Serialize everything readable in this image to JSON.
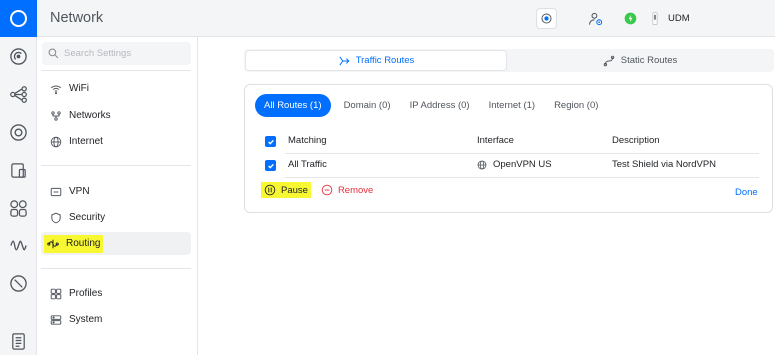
{
  "app": {
    "title": "Network"
  },
  "topbar": {
    "device_name": "UDM",
    "icons": [
      "settings-gear-icon",
      "admin-user-gear-icon",
      "status-ok-icon",
      "device-icon"
    ],
    "status_color": "#38c94a"
  },
  "rail": {
    "icons": [
      "ubiquiti-logo-icon",
      "dashboard-icon",
      "topology-icon",
      "devices-icon",
      "client-devices-icon",
      "users-icon",
      "insights-icon",
      "protect-shield-icon",
      "logs-icon"
    ]
  },
  "sidebar": {
    "search_placeholder": "Search Settings",
    "groups": [
      [
        {
          "label": "WiFi",
          "icon": "wifi-icon"
        },
        {
          "label": "Networks",
          "icon": "networks-icon"
        },
        {
          "label": "Internet",
          "icon": "globe-icon"
        }
      ],
      [
        {
          "label": "VPN",
          "icon": "vpn-icon"
        },
        {
          "label": "Security",
          "icon": "shield-icon"
        },
        {
          "label": "Routing",
          "icon": "routing-icon",
          "active": true,
          "highlighted": true
        }
      ],
      [
        {
          "label": "Profiles",
          "icon": "profiles-icon"
        },
        {
          "label": "System",
          "icon": "system-icon"
        }
      ]
    ]
  },
  "main": {
    "tabs": [
      {
        "label": "Traffic Routes",
        "icon": "traffic-routes-icon",
        "active": true
      },
      {
        "label": "Static Routes",
        "icon": "static-routes-icon",
        "active": false
      }
    ],
    "filters": [
      {
        "label": "All Routes (1)",
        "active": true
      },
      {
        "label": "Domain (0)",
        "active": false
      },
      {
        "label": "IP Address (0)",
        "active": false
      },
      {
        "label": "Internet (1)",
        "active": false
      },
      {
        "label": "Region (0)",
        "active": false
      }
    ],
    "table": {
      "columns": [
        "Matching",
        "Interface",
        "Description"
      ],
      "rows": [
        {
          "matching": "All Traffic",
          "interface": "OpenVPN US",
          "description": "Test Shield via NordVPN",
          "checked": true
        }
      ]
    },
    "actions": {
      "pause": "Pause",
      "remove": "Remove",
      "done": "Done"
    }
  },
  "colors": {
    "accent": "#006fff",
    "danger": "#e5303b",
    "highlight": "#f7f732"
  }
}
